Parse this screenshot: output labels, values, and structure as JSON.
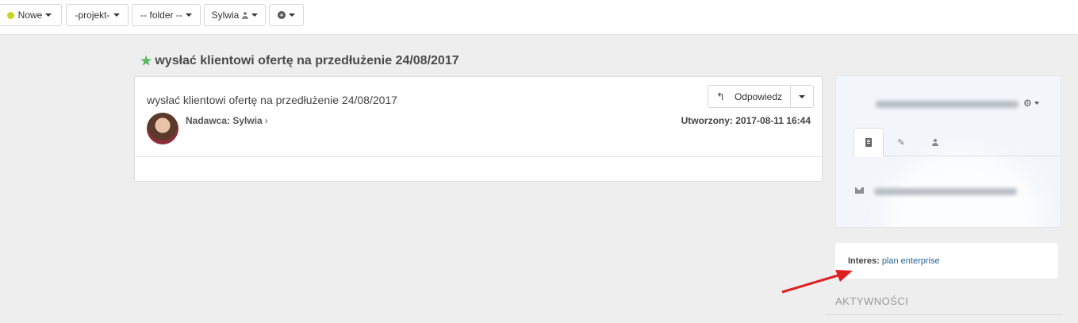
{
  "toolbar": {
    "status_label": "Nowe",
    "status_color": "#c9d61e",
    "project_label": "-projekt-",
    "folder_label": "-- folder --",
    "user_label": "Sylwia",
    "add_icon": "plus-circle-icon"
  },
  "page": {
    "title": "wysłać klientowi ofertę na przedłużenie 24/08/2017",
    "star_color": "#5cb85c"
  },
  "message": {
    "subject": "wysłać klientowi ofertę na przedłużenie 24/08/2017",
    "sender_label": "Nadawca: Sylwia",
    "created_label": "Utworzony: 2017-08-11 16:44",
    "reply_label": "Odpowiedz"
  },
  "contact": {
    "tabs": [
      "building-icon",
      "edit-icon",
      "user-icon"
    ],
    "active_tab": 0
  },
  "interes": {
    "label": "Interes:",
    "value": "plan enterprise"
  },
  "activity": {
    "heading": "AKTYWNOŚCI"
  },
  "annotation": {
    "arrow_color": "#e02020"
  }
}
